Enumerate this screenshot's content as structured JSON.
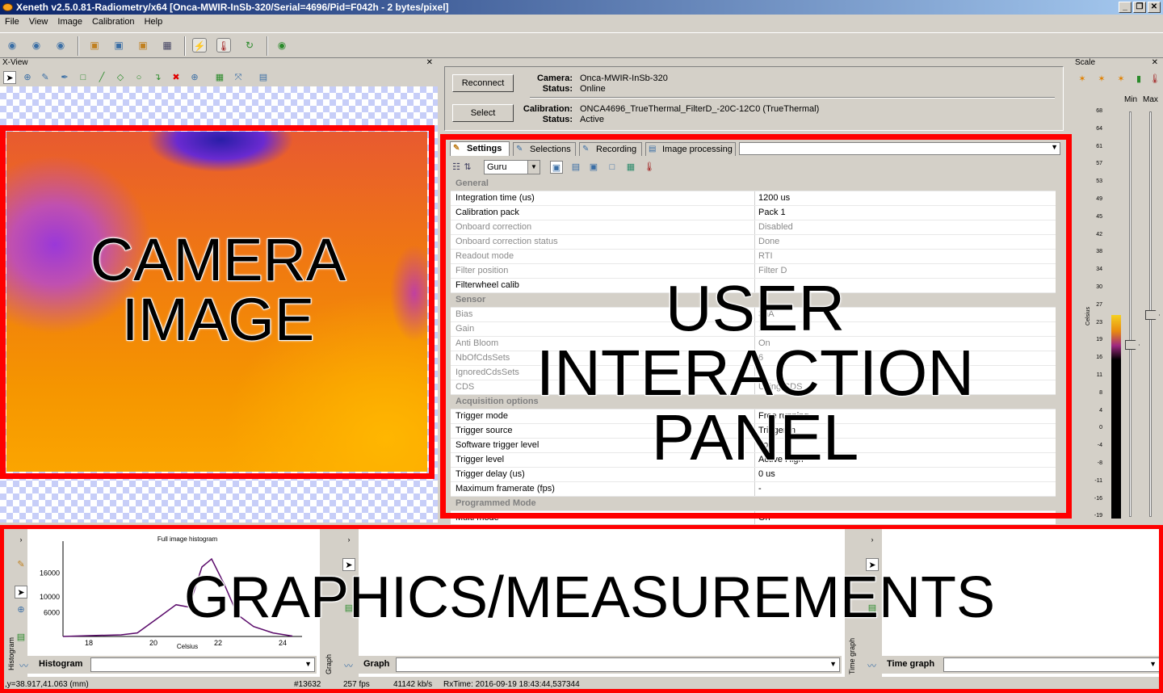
{
  "window": {
    "title": "Xeneth v2.5.0.81-Radiometry/x64 [Onca-MWIR-InSb-320/Serial=4696/Pid=F042h - 2 bytes/pixel]"
  },
  "menu": [
    "File",
    "View",
    "Image",
    "Calibration",
    "Help"
  ],
  "xview": {
    "title": "X-View"
  },
  "camera": {
    "reconnect_label": "Reconnect",
    "select_label": "Select",
    "camera_label": "Camera:",
    "camera_value": "Onca-MWIR-InSb-320",
    "status_label": "Status:",
    "status_value": "Online",
    "calibration_label": "Calibration:",
    "calibration_value": "ONCA4696_TrueThermal_FilterD_-20C-12C0 (TrueThermal)",
    "cal_status_label": "Status:",
    "cal_status_value": "Active"
  },
  "tabs": [
    "Settings",
    "Selections",
    "Recording",
    "Image processing"
  ],
  "level_select": "Guru",
  "properties": [
    {
      "cat": "General"
    },
    {
      "n": "Integration time (us)",
      "v": "1200 us"
    },
    {
      "n": "Calibration pack",
      "v": "Pack 1"
    },
    {
      "n": "Onboard correction",
      "v": "Disabled",
      "dis": true
    },
    {
      "n": "Onboard correction status",
      "v": "Done",
      "dis": true
    },
    {
      "n": "Readout mode",
      "v": "RTI",
      "dis": true
    },
    {
      "n": "Filter position",
      "v": "Filter D",
      "dis": true
    },
    {
      "n": "Filterwheel calib",
      "v": ""
    },
    {
      "cat": "Sensor"
    },
    {
      "n": "Bias",
      "v": "3nA",
      "dis": true
    },
    {
      "n": "Gain",
      "v": "100fF",
      "dis": true
    },
    {
      "n": "Anti Bloom",
      "v": "On",
      "dis": true
    },
    {
      "n": "NbOfCdsSets",
      "v": "6",
      "dis": true
    },
    {
      "n": "IgnoredCdsSets",
      "v": "2",
      "dis": true
    },
    {
      "n": "CDS",
      "v": "Using CDS",
      "dis": true
    },
    {
      "cat": "Acquisition options"
    },
    {
      "n": "Trigger mode",
      "v": "Free running"
    },
    {
      "n": "Trigger source",
      "v": "Trigger in"
    },
    {
      "n": "Software trigger level",
      "v": "Low"
    },
    {
      "n": "Trigger level",
      "v": "Active High"
    },
    {
      "n": "Trigger delay (us)",
      "v": "0 us"
    },
    {
      "n": "Maximum framerate (fps)",
      "v": "-"
    },
    {
      "cat": "Programmed Mode"
    },
    {
      "n": "Multi mode",
      "v": "On"
    }
  ],
  "scale": {
    "title": "Scale",
    "min_label": "Min",
    "max_label": "Max",
    "unit": "Celsius",
    "ticks": [
      "68",
      "64",
      "61",
      "57",
      "53",
      "49",
      "45",
      "42",
      "38",
      "34",
      "30",
      "27",
      "23",
      "19",
      "16",
      "11",
      "8",
      "4",
      "0",
      "-4",
      "-8",
      "-11",
      "-16",
      "-19"
    ]
  },
  "histogram": {
    "title": "Full image histogram",
    "xlabel": "Celsius",
    "name": "Histogram",
    "yticks": [
      "16000",
      "10000",
      "6000"
    ],
    "xticks": [
      "18",
      "20",
      "22",
      "24"
    ],
    "side_label": "Histogram"
  },
  "graph": {
    "name": "Graph",
    "side_label": "Graph"
  },
  "timegraph": {
    "name": "Time graph",
    "side_label": "Time graph"
  },
  "status": {
    "coords": ",y=38.917,41.063 (mm)",
    "frame": "#13632",
    "fps": "257 fps",
    "rate": "41142 kb/s",
    "rxtime": "RxTime: 2016-09-19 18:43:44,537344"
  },
  "overlays": {
    "camera": "CAMERA\nIMAGE",
    "uip": "USER INTERACTION\nPANEL",
    "graphics": "GRAPHICS/MEASUREMENTS"
  },
  "colors": {
    "highlight": "#ff0000",
    "titlebar": "#0a246a"
  }
}
